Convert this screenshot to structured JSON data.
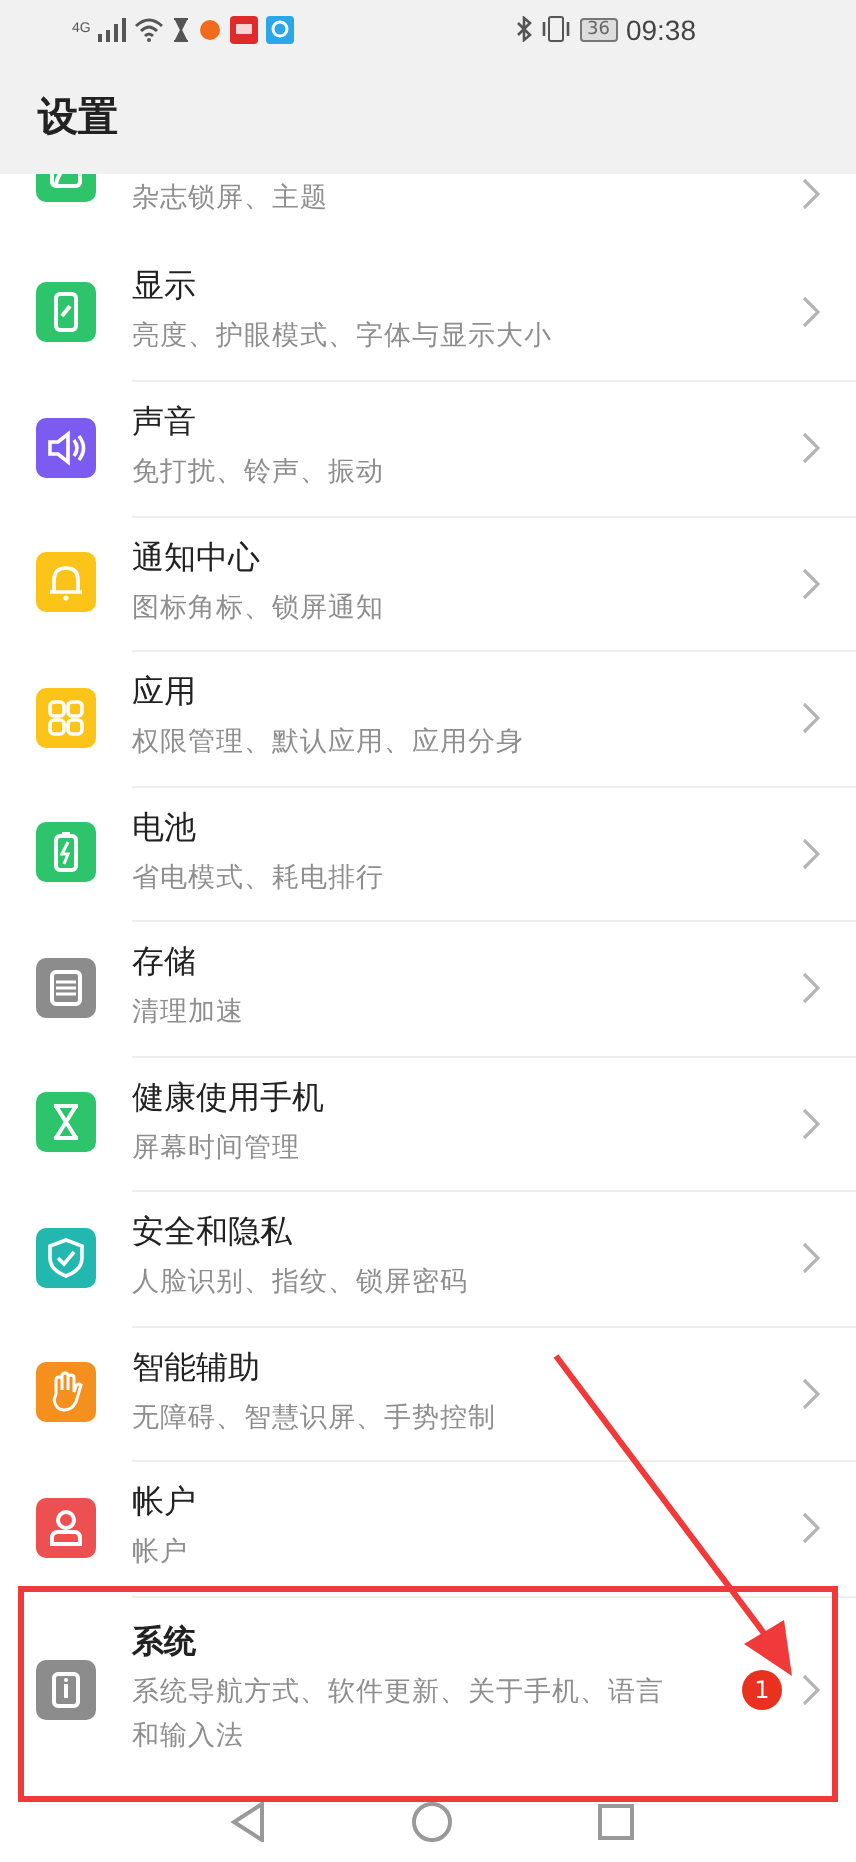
{
  "status_bar": {
    "network": "4G",
    "battery": "36",
    "time": "09:38"
  },
  "header": {
    "title": "设置"
  },
  "items": [
    {
      "kind": "partial",
      "subtitle": "杂志锁屏、主题",
      "color": "#2dc46c"
    },
    {
      "kind": "row",
      "title": "显示",
      "subtitle": "亮度、护眼模式、字体与显示大小",
      "color": "#2dc46c"
    },
    {
      "kind": "row",
      "title": "声音",
      "subtitle": "免打扰、铃声、振动",
      "color": "#7c5cf0"
    },
    {
      "kind": "row",
      "title": "通知中心",
      "subtitle": "图标角标、锁屏通知",
      "color": "#fcc419"
    },
    {
      "kind": "row",
      "title": "应用",
      "subtitle": "权限管理、默认应用、应用分身",
      "color": "#fcc419"
    },
    {
      "kind": "row",
      "title": "电池",
      "subtitle": "省电模式、耗电排行",
      "color": "#2dc46c"
    },
    {
      "kind": "row",
      "title": "存储",
      "subtitle": "清理加速",
      "color": "#8c8c8c"
    },
    {
      "kind": "row",
      "title": "健康使用手机",
      "subtitle": "屏幕时间管理",
      "color": "#2dc46c"
    },
    {
      "kind": "row",
      "title": "安全和隐私",
      "subtitle": "人脸识别、指纹、锁屏密码",
      "color": "#22b8b0"
    },
    {
      "kind": "row",
      "title": "智能辅助",
      "subtitle": "无障碍、智慧识屏、手势控制",
      "color": "#f5901e"
    },
    {
      "kind": "row",
      "title": "帐户",
      "subtitle": "帐户",
      "color": "#ec5050"
    },
    {
      "kind": "row",
      "title": "系统",
      "subtitle": "系统导航方式、软件更新、关于手机、语言和输入法",
      "color": "#8c8c8c",
      "badge": "1"
    }
  ]
}
